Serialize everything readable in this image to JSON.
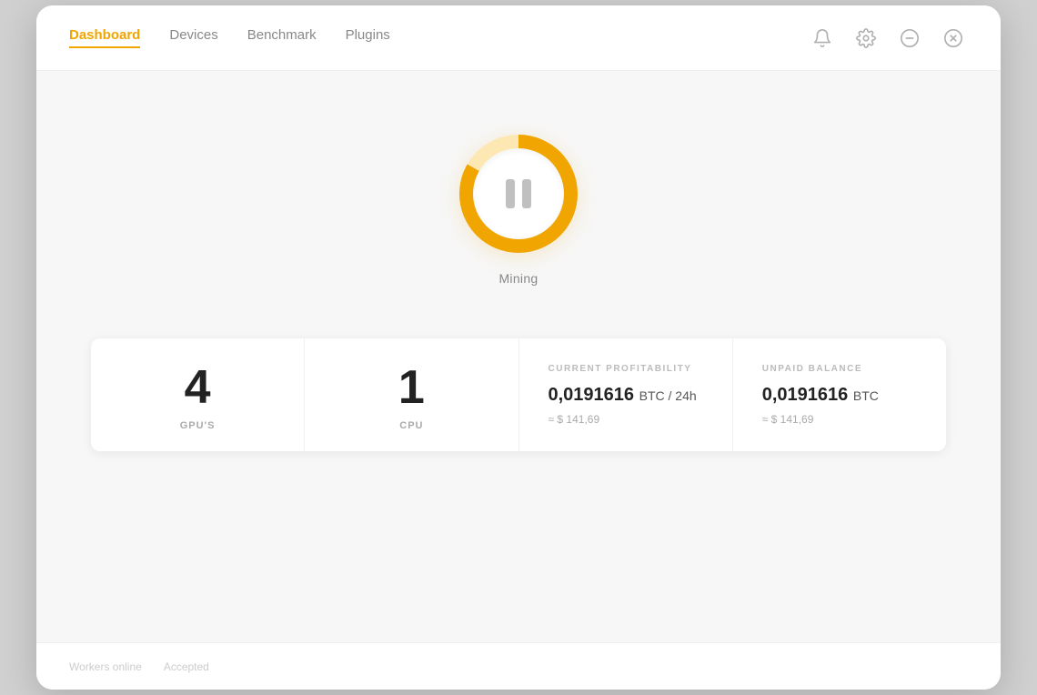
{
  "nav": {
    "items": [
      {
        "id": "dashboard",
        "label": "Dashboard",
        "active": true
      },
      {
        "id": "devices",
        "label": "Devices",
        "active": false
      },
      {
        "id": "benchmark",
        "label": "Benchmark",
        "active": false
      },
      {
        "id": "plugins",
        "label": "Plugins",
        "active": false
      }
    ]
  },
  "topActions": {
    "bell": "🔔",
    "gear": "⚙",
    "minimize": "—",
    "close": "✕"
  },
  "mining": {
    "status": "Mining",
    "buttonState": "paused"
  },
  "stats": {
    "gpus": {
      "value": "4",
      "label": "GPU'S"
    },
    "cpu": {
      "value": "1",
      "label": "CPU"
    },
    "profitability": {
      "sectionLabel": "CURRENT PROFITABILITY",
      "mainValue": "0,0191616",
      "unit": "BTC / 24h",
      "subValue": "≈ $ 141,69"
    },
    "unpaidBalance": {
      "sectionLabel": "UNPAID BALANCE",
      "mainValue": "0,0191616",
      "unit": "BTC",
      "subValue": "≈ $ 141,69"
    }
  },
  "bottomBar": {
    "text1": "Workers online",
    "text2": "Accepted"
  }
}
